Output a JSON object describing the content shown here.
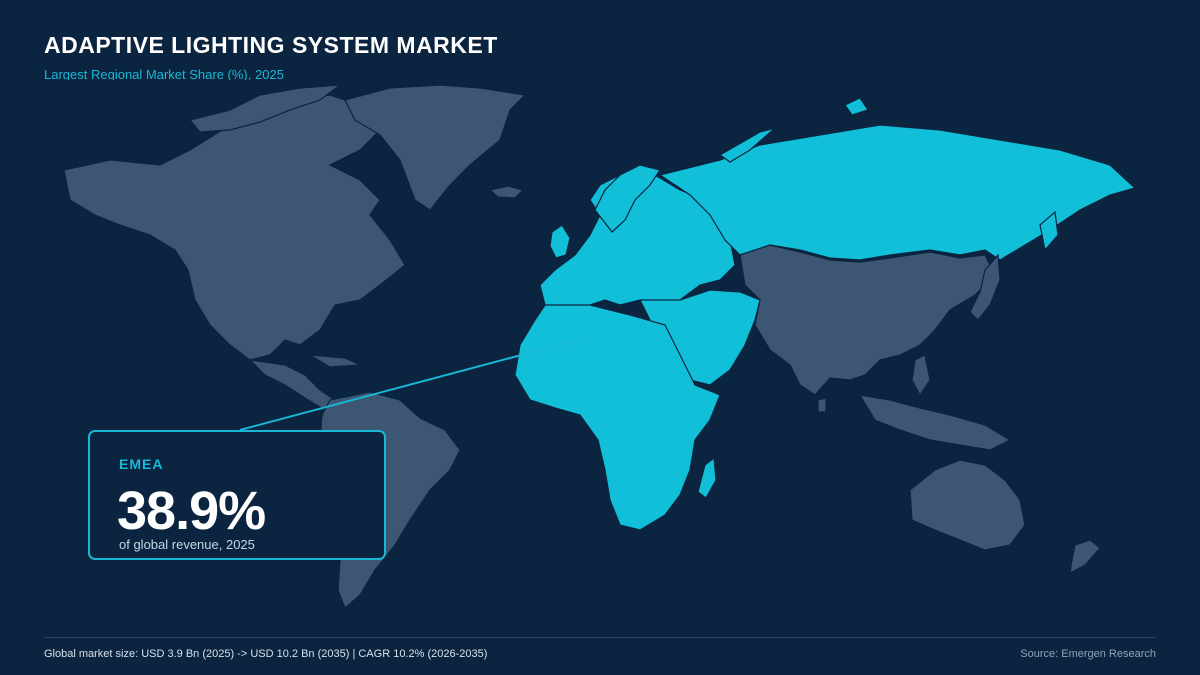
{
  "header": {
    "title": "ADAPTIVE LIGHTING SYSTEM MARKET",
    "subtitle": "Largest Regional Market Share (%), 2025"
  },
  "map": {
    "highlighted_region": "EMEA",
    "colors": {
      "highlight": "#12bfd8",
      "base": "#3c5673",
      "background": "#0b2540",
      "accent": "#19b7d6"
    }
  },
  "callout": {
    "region": "EMEA",
    "value": "38.9%",
    "caption": "of global revenue, 2025"
  },
  "footer": {
    "summary": "Global market size: USD 3.9 Bn (2025) -> USD 10.2 Bn (2035) | CAGR 10.2% (2026-2035)",
    "source": "Source: Emergen Research"
  }
}
